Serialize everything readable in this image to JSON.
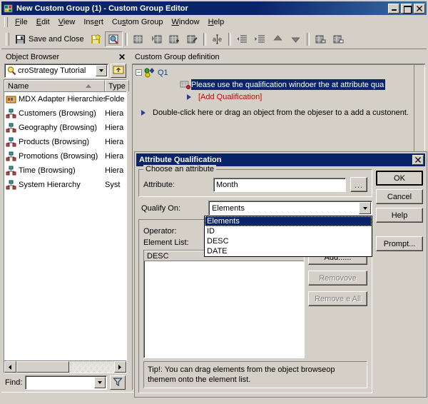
{
  "window": {
    "title": "New Custom Group (1) - Custom Group Editor",
    "icon": "custom-group-icon",
    "buttons": {
      "minimize": "_",
      "maximize": "□",
      "close": "✕"
    }
  },
  "menu": {
    "items": [
      {
        "label": "File",
        "accel": "F"
      },
      {
        "label": "Edit",
        "accel": "E"
      },
      {
        "label": "View",
        "accel": "V"
      },
      {
        "label": "Insert",
        "accel": "I"
      },
      {
        "label": "Custom Group",
        "accel": "s"
      },
      {
        "label": "Window",
        "accel": "W"
      },
      {
        "label": "Help",
        "accel": "H"
      }
    ]
  },
  "toolbar": {
    "save_and_close_label": "Save and Close",
    "items": [
      {
        "name": "save-and-close-button",
        "icon": "floppy-disk-icon"
      },
      {
        "name": "save-button",
        "icon": "floppy-disk-star-icon"
      },
      {
        "name": "preview-button",
        "icon": "preview-icon",
        "pressed": true
      },
      {
        "name": "new-element-button",
        "icon": "grid-block-icon"
      },
      {
        "name": "new-banding-button",
        "icon": "grid-arrow-icon"
      },
      {
        "name": "new-filter-button",
        "icon": "grid-plus-icon"
      },
      {
        "name": "properties-button",
        "icon": "grid-pencil-icon"
      },
      {
        "name": "rename-button",
        "icon": "text-edit-icon"
      },
      {
        "name": "promote-button",
        "icon": "indent-left-icon"
      },
      {
        "name": "demote-button",
        "icon": "indent-right-icon"
      },
      {
        "name": "move-up-button",
        "icon": "arrow-up-icon"
      },
      {
        "name": "move-down-button",
        "icon": "arrow-down-icon"
      },
      {
        "name": "group-button",
        "icon": "grid-group-icon"
      },
      {
        "name": "ungroup-button",
        "icon": "grid-ungroup-icon"
      }
    ]
  },
  "object_browser": {
    "title": "Object Browser",
    "close_label": "✕",
    "project_combo": {
      "value": "croStrategy Tutorial",
      "icon": "magnifier-icon"
    },
    "up_button_icon": "folder-up-icon",
    "columns": [
      "Name",
      "Type"
    ],
    "rows": [
      {
        "name": "MDX Adapter Hierarchies",
        "type": "Folde",
        "icon": "folder-icon"
      },
      {
        "name": "Customers (Browsing)",
        "type": "Hiera",
        "icon": "hierarchy-icon"
      },
      {
        "name": "Geography (Browsing)",
        "type": "Hiera",
        "icon": "hierarchy-icon"
      },
      {
        "name": "Products (Browsing)",
        "type": "Hiera",
        "icon": "hierarchy-icon"
      },
      {
        "name": "Promotions (Browsing)",
        "type": "Hiera",
        "icon": "hierarchy-icon"
      },
      {
        "name": "Time (Browsing)",
        "type": "Hiera",
        "icon": "hierarchy-icon"
      },
      {
        "name": "System Hierarchy",
        "type": "Syst",
        "icon": "hierarchy-icon"
      }
    ],
    "find": {
      "label": "Find:",
      "value": "",
      "filter_icon": "funnel-icon"
    }
  },
  "custom_group": {
    "panel_title": "Custom Group definition",
    "node_label": "Q1",
    "highlighted_text": "Please use the qualification windoer the at attribute qua",
    "add_qualification_label": "[Add Qualification]",
    "hint_text": "Double-click here or drag an object from the objeser to a add a custonent."
  },
  "dialog": {
    "title": "Attribute Qualification",
    "close_label": "✕",
    "group_attribute": {
      "legend": "Choose an attribute",
      "attribute_label": "Attribute:",
      "attribute_value": "Month",
      "browse_label": "..."
    },
    "qualify_on": {
      "label": "Qualify On:",
      "value": "Elements",
      "options": [
        "Elements",
        "ID",
        "DESC",
        "DATE"
      ],
      "selected_index": 0
    },
    "operator_label": "Operator:",
    "element_list_label": "Element List:",
    "element_list_header": "DESC",
    "element_list_rows": [],
    "buttons": {
      "add": "Add......",
      "remove": "Removove",
      "remove_all": "Remove e All",
      "ok": "OK",
      "cancel": "Cancel",
      "help": "Help",
      "prompt": "Prompt..."
    },
    "tip": "Tip!:  You can drag elements from the object browseop themem onto the element list."
  },
  "colors": {
    "titlebar": "#0a246a",
    "face": "#d4d0c8",
    "highlight": "#0a246a",
    "add_qual_red": "#d40000",
    "node_blue": "#0a4a8a"
  }
}
